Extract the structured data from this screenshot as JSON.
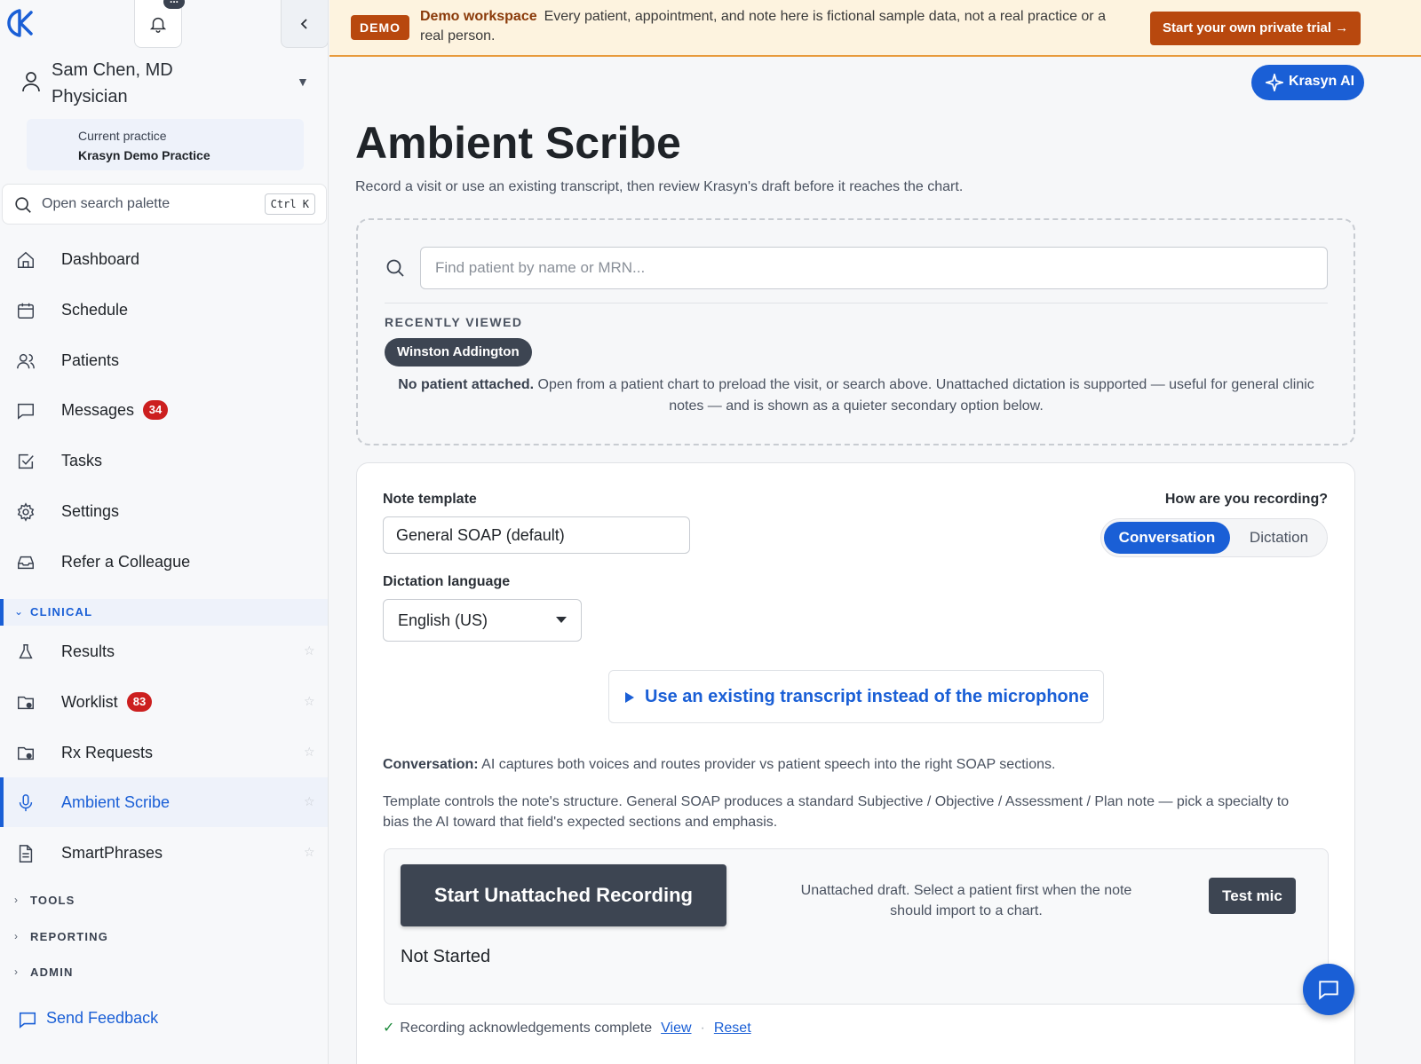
{
  "sidebar": {
    "user": {
      "name": "Sam Chen, MD",
      "role": "Physician"
    },
    "practice": {
      "label": "Current practice",
      "name": "Krasyn Demo Practice"
    },
    "search": {
      "label": "Open search palette",
      "shortcut": "Ctrl K"
    },
    "bell_badge": "...",
    "nav": [
      {
        "label": "Dashboard",
        "icon": "home-icon"
      },
      {
        "label": "Schedule",
        "icon": "calendar-icon"
      },
      {
        "label": "Patients",
        "icon": "users-icon"
      },
      {
        "label": "Messages",
        "icon": "message-icon",
        "badge": "34"
      },
      {
        "label": "Tasks",
        "icon": "checkbox-icon"
      },
      {
        "label": "Settings",
        "icon": "gear-icon"
      },
      {
        "label": "Refer a Colleague",
        "icon": "inbox-icon"
      }
    ],
    "sections": {
      "clinical": "CLINICAL",
      "tools": "TOOLS",
      "reporting": "REPORTING",
      "admin": "ADMIN"
    },
    "clinical_items": [
      {
        "label": "Results",
        "icon": "flask-icon"
      },
      {
        "label": "Worklist",
        "icon": "folder-icon",
        "badge": "83"
      },
      {
        "label": "Rx Requests",
        "icon": "folder-icon"
      },
      {
        "label": "Ambient Scribe",
        "icon": "microphone-icon",
        "active": true
      },
      {
        "label": "SmartPhrases",
        "icon": "document-icon"
      }
    ],
    "star": "☆",
    "feedback": "Send Feedback"
  },
  "banner": {
    "pill": "DEMO",
    "title": "Demo workspace",
    "text": "Every patient, appointment, and note here is fictional sample data, not a real practice or a real person.",
    "cta": "Start your own private trial →"
  },
  "ai_button": "Krasyn AI",
  "page": {
    "title": "Ambient Scribe",
    "subtitle": "Record a visit or use an existing transcript, then review Krasyn's draft before it reaches the chart."
  },
  "patient": {
    "search_placeholder": "Find patient by name or MRN...",
    "recent_label": "RECENTLY VIEWED",
    "recent_chip": "Winston Addington",
    "no_patient_bold": "No patient attached.",
    "no_patient_text": " Open from a patient chart to preload the visit, or search above. Unattached dictation is supported — useful for general clinic notes — and is shown as a quieter secondary option below."
  },
  "form": {
    "template_label": "Note template",
    "template_value": "General SOAP (default)",
    "language_label": "Dictation language",
    "language_value": "English (US)",
    "recording_question": "How are you recording?",
    "mode_conversation": "Conversation",
    "mode_dictation": "Dictation",
    "transcript_link": "Use an existing transcript instead of the microphone",
    "conv_bold": "Conversation:",
    "conv_text": " AI captures both voices and routes provider vs patient speech into the right SOAP sections.",
    "template_desc": "Template controls the note's structure. General SOAP produces a standard Subjective / Objective / Assessment / Plan note — pick a specialty to bias the AI toward that field's expected sections and emphasis."
  },
  "recorder": {
    "start": "Start Unattached Recording",
    "note": "Unattached draft. Select a patient first when the note should import to a chart.",
    "test_mic": "Test mic",
    "status": "Not Started"
  },
  "ack": {
    "check": "✓",
    "text": "Recording acknowledgements complete",
    "view": "View",
    "sep": "·",
    "reset": "Reset"
  },
  "colors": {
    "accent": "#1a5fd6",
    "demo": "#b8480e",
    "badge": "#cc1f1f",
    "dark_button": "#3d4552"
  }
}
